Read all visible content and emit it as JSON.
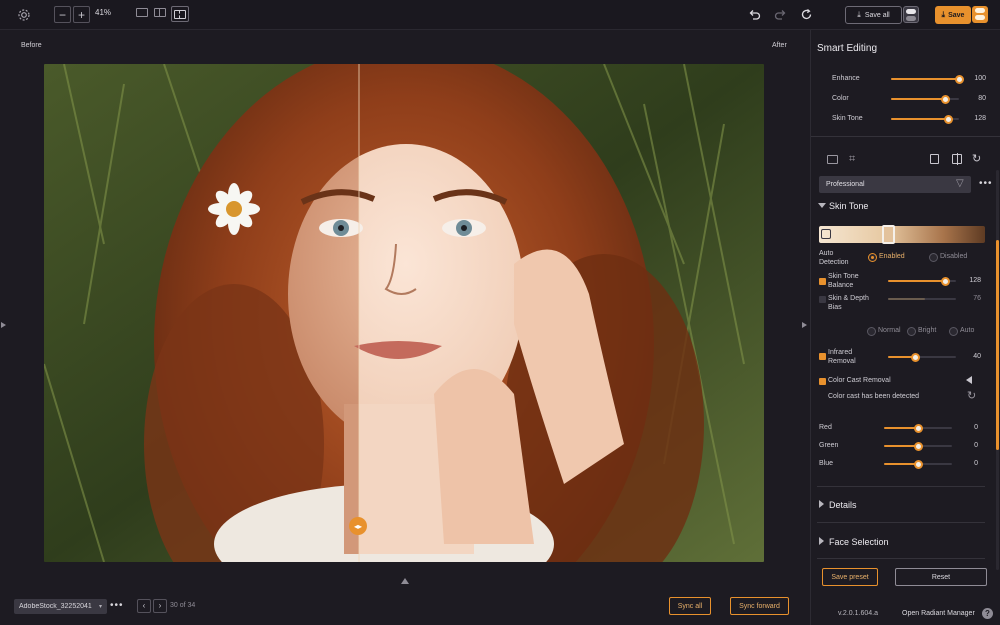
{
  "toolbar": {
    "zoom": "41%",
    "save_all_label": "Save all",
    "save_label": "Save"
  },
  "canvas": {
    "before_label": "Before",
    "after_label": "After"
  },
  "bottom": {
    "file_name": "AdobeStock_32252041",
    "page_counter": "30 of 34",
    "sync_all_label": "Sync all",
    "sync_forward_label": "Sync forward"
  },
  "panel": {
    "title": "Smart Editing",
    "sliders_top": [
      {
        "label": "Enhance",
        "value": "100",
        "level": 1.0
      },
      {
        "label": "Color",
        "value": "80",
        "level": 0.8
      },
      {
        "label": "Skin Tone",
        "value": "128",
        "level": 0.85
      }
    ],
    "preset": "Professional",
    "skin_tone": {
      "section_title": "Skin Tone",
      "auto_detection_label": "Auto\nDetection",
      "enabled_label": "Enabled",
      "disabled_label": "Disabled",
      "balance_label": "Skin Tone\nBalance",
      "balance_value": "128",
      "balance_level": 0.85,
      "depth_label": "Skin & Depth\nBias",
      "depth_value": "76",
      "depth_level": 0.55,
      "normal_label": "Normal",
      "bright_label": "Bright",
      "auto_label": "Auto",
      "infrared_label": "Infrared\nRemoval",
      "infrared_value": "40",
      "infrared_level": 0.4,
      "cast_label": "Color Cast Removal",
      "cast_detected": "Color cast has been detected",
      "rgb": [
        {
          "label": "Red",
          "value": "0",
          "level": 0.5
        },
        {
          "label": "Green",
          "value": "0",
          "level": 0.5
        },
        {
          "label": "Blue",
          "value": "0",
          "level": 0.5
        }
      ]
    },
    "details_label": "Details",
    "face_selection_label": "Face Selection",
    "save_preset_label": "Save preset",
    "reset_label": "Reset",
    "version": "v.2.0.1.604.a",
    "manager_label": "Open Radiant Manager",
    "help_label": "?"
  },
  "colors": {
    "accent": "#e8912d",
    "background": "#1d1b22",
    "panel": "#1d1b22"
  }
}
